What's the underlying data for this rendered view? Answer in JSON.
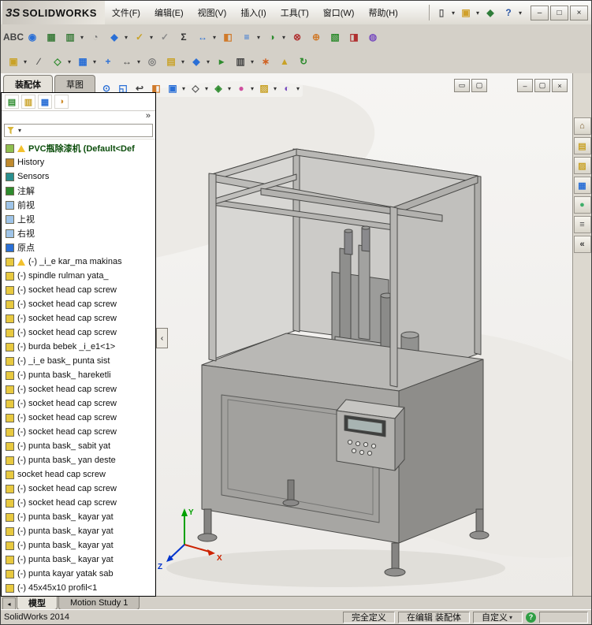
{
  "app": {
    "logo_mark": "3S",
    "logo_name": "SOLIDWORKS",
    "window_buttons": [
      {
        "name": "minimize-button",
        "glyph": "–"
      },
      {
        "name": "maximize-button",
        "glyph": "□"
      },
      {
        "name": "close-button",
        "glyph": "×"
      }
    ]
  },
  "ui": {
    "caret": "▾",
    "chevron": "»",
    "flyout": "‹",
    "tab_scroll": "◂"
  },
  "menu": {
    "items": [
      {
        "label": "文件(F)"
      },
      {
        "label": "编辑(E)"
      },
      {
        "label": "视图(V)"
      },
      {
        "label": "插入(I)"
      },
      {
        "label": "工具(T)"
      },
      {
        "label": "窗口(W)"
      },
      {
        "label": "帮助(H)"
      }
    ]
  },
  "titlebar_tools": [
    {
      "name": "new-document-icon",
      "glyph": "▯",
      "fg": "#5a5a5a",
      "caret": true
    },
    {
      "name": "open-document-icon",
      "glyph": "▣",
      "fg": "#d0a02a",
      "caret": true
    },
    {
      "name": "publish-edrawings-icon",
      "glyph": "◆",
      "fg": "#2f7d3a",
      "caret": false
    },
    {
      "name": "help-icon",
      "glyph": "?",
      "fg": "#2a56a5",
      "caret": true
    }
  ],
  "toolbar_standard": {
    "icons": [
      {
        "name": "spell-check-icon",
        "glyph": "ABC",
        "fg": "#444444",
        "small": true,
        "caret": false
      },
      {
        "name": "search-icon",
        "glyph": "◉",
        "fg": "#2a6fd6",
        "caret": false
      },
      {
        "name": "design-table-icon",
        "glyph": "▦",
        "fg": "#3d7d3d",
        "caret": false
      },
      {
        "name": "excel-table-icon",
        "glyph": "▥",
        "fg": "#3d7d3d",
        "caret": true
      },
      {
        "name": "performance-icon",
        "glyph": "◔",
        "fg": "#777777",
        "caret": false
      },
      {
        "name": "mass-properties-icon",
        "glyph": "◆",
        "fg": "#2a6fd6",
        "caret": true
      },
      {
        "name": "check-active-doc-icon",
        "glyph": "✓",
        "fg": "#c9a227",
        "caret": true
      },
      {
        "name": "check-gray-icon",
        "glyph": "✓",
        "fg": "#8a8a8a",
        "caret": false
      },
      {
        "name": "equations-icon",
        "glyph": "Σ",
        "fg": "#333333",
        "caret": false
      },
      {
        "name": "measure-icon",
        "glyph": "↔",
        "fg": "#2a6fd6",
        "caret": true
      },
      {
        "name": "section-properties-icon",
        "glyph": "◧",
        "fg": "#d07a2a",
        "caret": false
      },
      {
        "name": "reorder-icon",
        "glyph": "≡",
        "fg": "#2a6fd6",
        "caret": true
      },
      {
        "name": "paint-icon",
        "glyph": "◑",
        "fg": "#2e8b2e",
        "caret": true
      },
      {
        "name": "interference-detection-icon",
        "glyph": "⊗",
        "fg": "#b03030",
        "caret": false
      },
      {
        "name": "hole-alignment-icon",
        "glyph": "⊕",
        "fg": "#d07a2a",
        "caret": false
      },
      {
        "name": "visualization-icon",
        "glyph": "▧",
        "fg": "#2e8b2e",
        "caret": false
      },
      {
        "name": "costing-icon",
        "glyph": "◨",
        "fg": "#b03030",
        "caret": false
      },
      {
        "name": "photoview-icon",
        "glyph": "◍",
        "fg": "#7a4fbf",
        "caret": false
      }
    ]
  },
  "toolbar_assembly": {
    "icons": [
      {
        "name": "insert-component-icon",
        "glyph": "▣",
        "fg": "#c9a227",
        "caret": true
      },
      {
        "name": "pen-icon",
        "glyph": "∕",
        "fg": "#555555",
        "caret": false
      },
      {
        "name": "mate-icon",
        "glyph": "◇",
        "fg": "#2e8b2e",
        "caret": true
      },
      {
        "name": "linear-pattern-icon",
        "glyph": "▦",
        "fg": "#2a6fd6",
        "caret": true
      },
      {
        "name": "smart-fasteners-icon",
        "glyph": "+",
        "fg": "#2a6fd6",
        "caret": false
      },
      {
        "name": "move-component-icon",
        "glyph": "↔",
        "fg": "#444444",
        "caret": true
      },
      {
        "name": "show-hidden-icon",
        "glyph": "◎",
        "fg": "#777777",
        "caret": false
      },
      {
        "name": "assembly-features-icon",
        "glyph": "▤",
        "fg": "#c9a227",
        "caret": true
      },
      {
        "name": "reference-geometry-icon",
        "glyph": "◆",
        "fg": "#2a6fd6",
        "caret": true
      },
      {
        "name": "new-motion-study-icon",
        "glyph": "▸",
        "fg": "#2e8b2e",
        "caret": false
      },
      {
        "name": "bom-icon",
        "glyph": "▥",
        "fg": "#444444",
        "caret": true
      },
      {
        "name": "exploded-view-icon",
        "glyph": "∗",
        "fg": "#d06020",
        "caret": false
      },
      {
        "name": "instant3d-icon",
        "glyph": "▲",
        "fg": "#c9a227",
        "caret": false
      },
      {
        "name": "update-icon",
        "glyph": "↻",
        "fg": "#2e8b2e",
        "caret": false
      }
    ]
  },
  "cmd_tabs": [
    {
      "label": "装配体"
    },
    {
      "label": "草图"
    }
  ],
  "headsup": {
    "icons": [
      {
        "name": "zoom-fit-icon",
        "glyph": "⊙",
        "fg": "#2a6fd6",
        "caret": false
      },
      {
        "name": "zoom-area-icon",
        "glyph": "◱",
        "fg": "#2a6fd6",
        "caret": false
      },
      {
        "name": "previous-view-icon",
        "glyph": "↩",
        "fg": "#444444",
        "caret": false
      },
      {
        "name": "section-view-icon",
        "glyph": "◧",
        "fg": "#d07a2a",
        "caret": false
      },
      {
        "name": "view-orientation-icon",
        "glyph": "▣",
        "fg": "#2a6fd6",
        "caret": true
      },
      {
        "name": "display-style-icon",
        "glyph": "◇",
        "fg": "#555555",
        "caret": true
      },
      {
        "name": "hide-show-items-icon",
        "glyph": "◈",
        "fg": "#2e8b2e",
        "caret": true
      },
      {
        "name": "edit-appearance-icon",
        "glyph": "●",
        "fg": "#cf4f9f",
        "caret": true
      },
      {
        "name": "apply-scene-icon",
        "glyph": "▨",
        "fg": "#c9a227",
        "caret": true
      },
      {
        "name": "view-settings-icon",
        "glyph": "◐",
        "fg": "#7a4fbf",
        "caret": true
      }
    ],
    "frame_buttons": [
      {
        "name": "frame-toggle-icon",
        "glyph": "▭"
      },
      {
        "name": "fullscreen-icon",
        "glyph": "▢"
      }
    ],
    "doc_buttons": [
      {
        "name": "doc-minimize-button",
        "glyph": "–"
      },
      {
        "name": "doc-restore-button",
        "glyph": "▢"
      },
      {
        "name": "doc-close-button",
        "glyph": "×"
      }
    ]
  },
  "fm": {
    "tabs": [
      {
        "name": "featuremanager-tab-icon",
        "glyph": "▤",
        "fg": "#2e8b2e"
      },
      {
        "name": "propertymanager-tab-icon",
        "glyph": "▥",
        "fg": "#c9a227"
      },
      {
        "name": "configurationmanager-tab-icon",
        "glyph": "▦",
        "fg": "#2a6fd6"
      },
      {
        "name": "displaymanager-tab-icon",
        "glyph": "◑",
        "fg": "#cf8f2f"
      }
    ],
    "root": {
      "label": "PVC瓶除漆机 (Default<Def"
    },
    "folders": [
      {
        "label": "History",
        "color": "#c08a2e"
      },
      {
        "label": "Sensors",
        "color": "#2a8f8f"
      },
      {
        "label": "注解",
        "color": "#2e8b2e"
      },
      {
        "label": "前视",
        "color": "#9fc4e8"
      },
      {
        "label": "上视",
        "color": "#9fc4e8"
      },
      {
        "label": "右视",
        "color": "#9fc4e8"
      },
      {
        "label": "原点",
        "color": "#2a6fd6"
      }
    ],
    "components": [
      {
        "label": "(-) _i_e kar_ma makinas",
        "warn": true
      },
      {
        "label": "(-) spindle rulman yata_",
        "warn": false
      },
      {
        "label": "(-) socket head cap screw",
        "warn": false
      },
      {
        "label": "(-) socket head cap screw",
        "warn": false
      },
      {
        "label": "(-) socket head cap screw",
        "warn": false
      },
      {
        "label": "(-) socket head cap screw",
        "warn": false
      },
      {
        "label": "(-) burda bebek _i_e1<1>",
        "warn": false
      },
      {
        "label": "(-) _i_e bask_ punta sist",
        "warn": false
      },
      {
        "label": "(-) punta bask_ hareketli",
        "warn": false
      },
      {
        "label": "(-) socket head cap screw",
        "warn": false
      },
      {
        "label": "(-) socket head cap screw",
        "warn": false
      },
      {
        "label": "(-) socket head cap screw",
        "warn": false
      },
      {
        "label": "(-) socket head cap screw",
        "warn": false
      },
      {
        "label": "(-) punta bask_ sabit yat",
        "warn": false
      },
      {
        "label": "(-) punta bask_ yan deste",
        "warn": false
      },
      {
        "label": "socket head cap screw",
        "warn": false
      },
      {
        "label": "(-) socket head cap screw",
        "warn": false
      },
      {
        "label": "(-) socket head cap screw",
        "warn": false
      },
      {
        "label": "(-) punta bask_ kayar yat",
        "warn": false
      },
      {
        "label": "(-) punta bask_ kayar yat",
        "warn": false
      },
      {
        "label": "(-) punta bask_ kayar yat",
        "warn": false
      },
      {
        "label": "(-) punta bask_ kayar yat",
        "warn": false
      },
      {
        "label": "(-) punta kayar yatak sab",
        "warn": false
      },
      {
        "label": "(-) 45x45x10 profil<1",
        "warn": false
      }
    ]
  },
  "taskpane": {
    "icons": [
      {
        "name": "home-icon",
        "glyph": "⌂",
        "fg": "#7a5a2a"
      },
      {
        "name": "design-library-icon",
        "glyph": "▤",
        "fg": "#c9a227"
      },
      {
        "name": "file-explorer-icon",
        "glyph": "▨",
        "fg": "#c9a227"
      },
      {
        "name": "view-palette-icon",
        "glyph": "▦",
        "fg": "#2a6fd6"
      },
      {
        "name": "appearances-icon",
        "glyph": "●",
        "fg": "#3fae6a"
      },
      {
        "name": "custom-properties-icon",
        "glyph": "≡",
        "fg": "#555555"
      },
      {
        "name": "collapse-taskpane-icon",
        "glyph": "«",
        "fg": "#333333"
      }
    ]
  },
  "viewport": {
    "triad": {
      "x": "X",
      "y": "Y",
      "z": "Z"
    }
  },
  "sheet_tabs": {
    "tabs": [
      {
        "label": "模型"
      },
      {
        "label": "Motion Study 1"
      }
    ]
  },
  "status": {
    "app": "SolidWorks 2014",
    "defined": "完全定义",
    "editing": "在编辑 装配体",
    "custom": "自定义",
    "help": "?"
  }
}
